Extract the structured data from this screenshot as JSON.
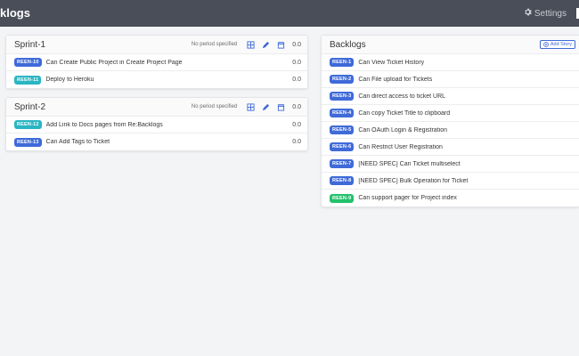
{
  "navbar": {
    "brand": "klogs",
    "settings_label": "Settings",
    "settings_icon": "gear-icon"
  },
  "colors": {
    "navbar": "#4a4e58",
    "tag_blue": "#3f6ad8",
    "tag_cyan": "#2bb5c3",
    "tag_green": "#23c16b"
  },
  "sprints": [
    {
      "title": "Sprint-1",
      "period": "No period specified",
      "points": "0.0",
      "items": [
        {
          "key": "REEN-10",
          "title": "Can Create Public Project in Create Project Page",
          "points": "0.0",
          "color": "blue"
        },
        {
          "key": "REEN-11",
          "title": "Deploy to Heroku",
          "points": "0.0",
          "color": "cyan"
        }
      ]
    },
    {
      "title": "Sprint-2",
      "period": "No period specified",
      "points": "0.0",
      "items": [
        {
          "key": "REEN-12",
          "title": "Add Link to Docs pages from Re:Backlogs",
          "points": "0.0",
          "color": "cyan"
        },
        {
          "key": "REEN-13",
          "title": "Can Add Tags to Ticket",
          "points": "0.0",
          "color": "blue"
        }
      ]
    }
  ],
  "backlogs": {
    "title": "Backlogs",
    "add_story_label": "Add Story",
    "items": [
      {
        "key": "REEN-1",
        "title": "Can View Ticket History",
        "color": "blue"
      },
      {
        "key": "REEN-2",
        "title": "Can File upload for Tickets",
        "color": "blue"
      },
      {
        "key": "REEN-3",
        "title": "Can direct access to ticket URL",
        "color": "blue"
      },
      {
        "key": "REEN-4",
        "title": "Can copy Ticket Title to clipboard",
        "color": "blue"
      },
      {
        "key": "REEN-5",
        "title": "Can OAuth Login & Registration",
        "color": "blue"
      },
      {
        "key": "REEN-6",
        "title": "Can Restrict User Registration",
        "color": "blue"
      },
      {
        "key": "REEN-7",
        "title": "[NEED SPEC] Can Ticket multiselect",
        "color": "blue"
      },
      {
        "key": "REEN-8",
        "title": "[NEED SPEC] Bulk Operation for Ticket",
        "color": "blue"
      },
      {
        "key": "REEN-9",
        "title": "Can support pager for Project index",
        "color": "green"
      }
    ]
  }
}
